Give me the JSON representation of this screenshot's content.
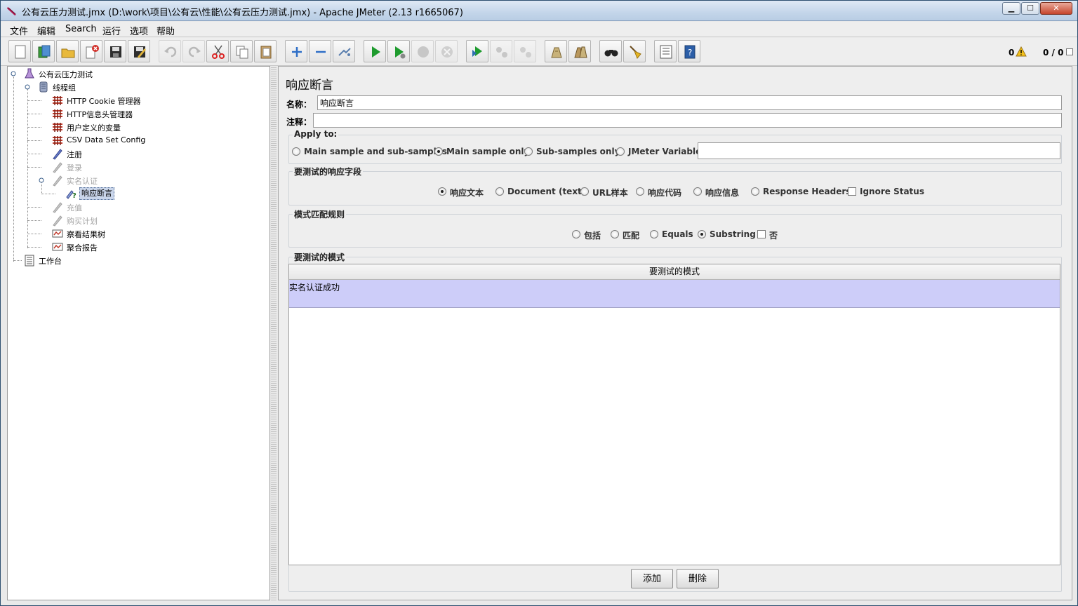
{
  "window": {
    "title": "公有云压力测试.jmx (D:\\work\\项目\\公有云\\性能\\公有云压力测试.jmx) - Apache JMeter (2.13 r1665067)",
    "minimize": "▁",
    "maximize": "☐",
    "close": "✕"
  },
  "menu": [
    "文件",
    "编辑",
    "Search",
    "运行",
    "选项",
    "帮助"
  ],
  "toolbar": {
    "buttons": [
      "new-icon",
      "templates-icon",
      "open-icon",
      "close-file-icon",
      "save-icon",
      "save-as-icon",
      "undo-icon",
      "redo-icon",
      "cut-icon",
      "copy-icon",
      "paste-icon",
      "expand-icon",
      "collapse-icon",
      "toggle-icon",
      "start-icon",
      "start-no-pause-icon",
      "stop-icon",
      "shutdown-icon",
      "remote-start-icon",
      "remote-stop-icon",
      "remote-shutdown-icon",
      "clear-icon",
      "clear-all-icon",
      "search-icon",
      "reset-search-icon",
      "function-helper-icon",
      "help-icon"
    ],
    "error_count": "0",
    "thread_count": "0 / 0"
  },
  "tree": {
    "nodes": [
      {
        "label": "公有云压力测试",
        "icon": "test-plan-icon"
      },
      {
        "label": "线程组",
        "icon": "thread-group-icon"
      },
      {
        "label": "HTTP Cookie 管理器",
        "icon": "config-icon"
      },
      {
        "label": "HTTP信息头管理器",
        "icon": "config-icon"
      },
      {
        "label": "用户定义的变量",
        "icon": "config-icon"
      },
      {
        "label": "CSV Data Set Config",
        "icon": "config-icon"
      },
      {
        "label": "注册",
        "icon": "sampler-icon"
      },
      {
        "label": "登录",
        "icon": "sampler-icon"
      },
      {
        "label": "实名认证",
        "icon": "sampler-icon"
      },
      {
        "label": "响应断言",
        "icon": "assertion-icon"
      },
      {
        "label": "充值",
        "icon": "sampler-icon"
      },
      {
        "label": "购买计划",
        "icon": "sampler-icon"
      },
      {
        "label": "察看结果树",
        "icon": "listener-icon"
      },
      {
        "label": "聚合报告",
        "icon": "listener-icon"
      },
      {
        "label": "工作台",
        "icon": "workbench-icon"
      }
    ]
  },
  "editor": {
    "title": "响应断言",
    "name_label": "名称：",
    "name_value": "响应断言",
    "comment_label": "注释：",
    "comment_value": "",
    "apply_to": {
      "title": "Apply to:",
      "options": [
        "Main sample and sub-samples",
        "Main sample only",
        "Sub-samples only",
        "JMeter Variable"
      ],
      "selected": "Main sample only",
      "variable_value": ""
    },
    "response_field": {
      "title": "要测试的响应字段",
      "options": [
        "响应文本",
        "Document (text)",
        "URL样本",
        "响应代码",
        "响应信息",
        "Response Headers"
      ],
      "selected": "响应文本",
      "ignore_status": "Ignore Status"
    },
    "pattern_rules": {
      "title": "模式匹配规则",
      "options": [
        "包括",
        "匹配",
        "Equals",
        "Substring"
      ],
      "selected": "Substring",
      "not_label": "否"
    },
    "patterns": {
      "title": "要测试的模式",
      "column": "要测试的模式",
      "rows": [
        "实名认证成功"
      ]
    },
    "add_button": "添加",
    "delete_button": "删除"
  }
}
